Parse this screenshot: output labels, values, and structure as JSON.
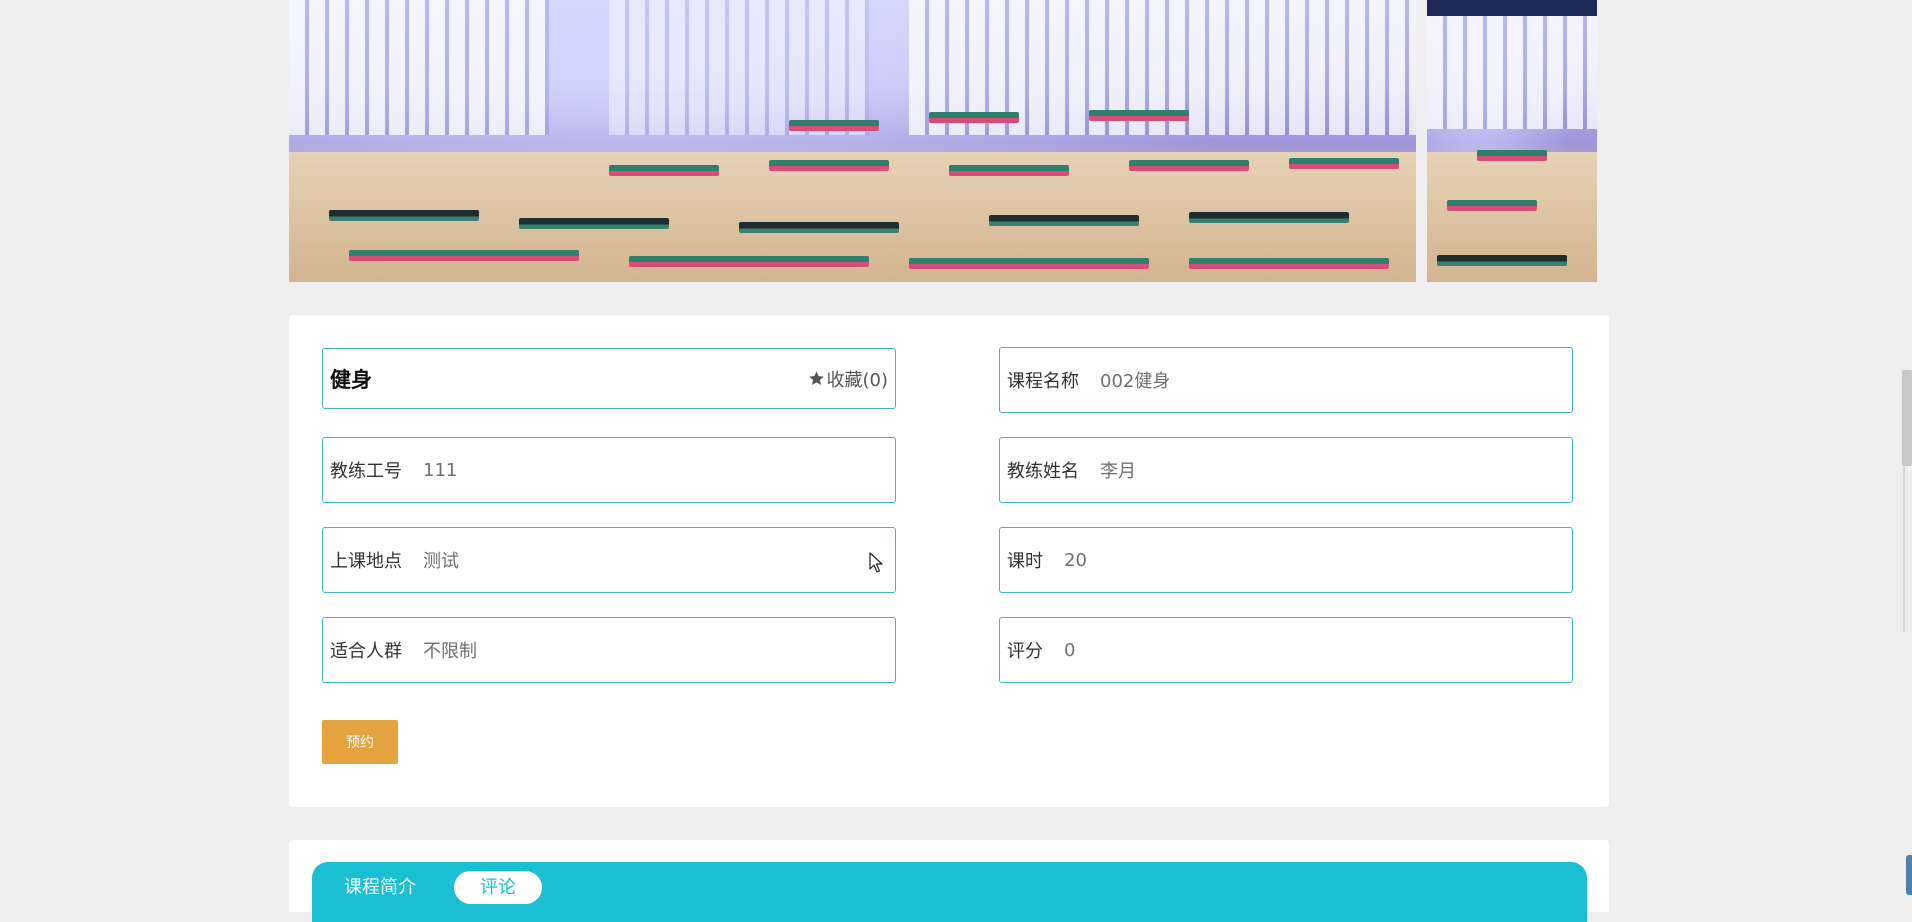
{
  "course": {
    "category": "健身",
    "favorite_label": "收藏(0)",
    "fields": {
      "course_name": {
        "label": "课程名称",
        "value": "002健身"
      },
      "coach_id": {
        "label": "教练工号",
        "value": "111"
      },
      "coach_name": {
        "label": "教练姓名",
        "value": "李月"
      },
      "location": {
        "label": "上课地点",
        "value": "测试"
      },
      "hours": {
        "label": "课时",
        "value": "20"
      },
      "audience": {
        "label": "适合人群",
        "value": "不限制"
      },
      "rating": {
        "label": "评分",
        "value": "0"
      }
    },
    "book_label": "预约"
  },
  "tabs": {
    "items": [
      {
        "label": "课程简介",
        "active": false
      },
      {
        "label": "评论",
        "active": true
      }
    ]
  },
  "colors": {
    "accent": "#1bbfd3",
    "field_border": "#3eb6c4",
    "book_button": "#e6a440",
    "page_bg": "#efefef"
  },
  "icons": {
    "favorite": "star-icon",
    "pointer": "mouse-cursor-icon"
  }
}
